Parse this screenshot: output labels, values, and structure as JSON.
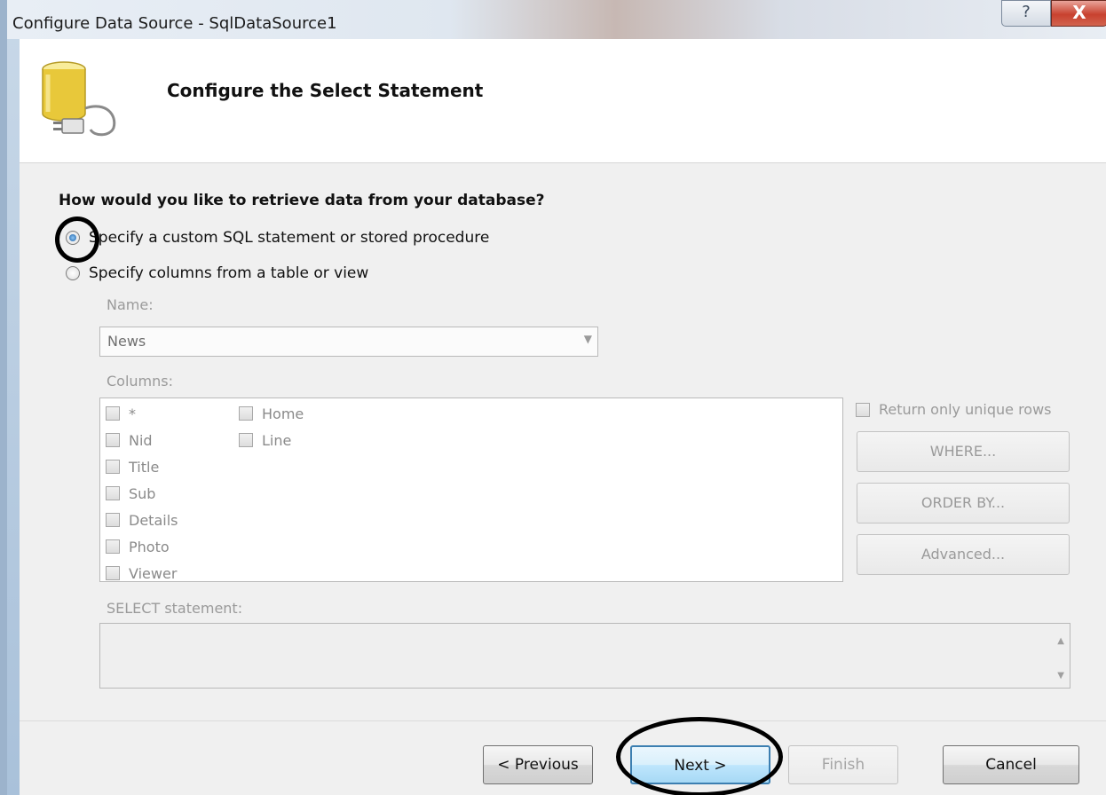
{
  "window": {
    "title": "Configure Data Source - SqlDataSource1",
    "help_label": "?",
    "close_label": "X"
  },
  "header": {
    "title": "Configure the Select Statement",
    "icon": "database-plug-icon"
  },
  "question": "How would you like to retrieve data from your database?",
  "options": {
    "custom_sql": {
      "label": "Specify a custom SQL statement or stored procedure",
      "selected": true
    },
    "table_view": {
      "label": "Specify columns from a table or view",
      "selected": false
    }
  },
  "name_field": {
    "label": "Name:",
    "value": "News"
  },
  "columns": {
    "label": "Columns:",
    "col1": [
      "*",
      "Nid",
      "Title",
      "Sub",
      "Details",
      "Photo",
      "Viewer"
    ],
    "col2": [
      "Home",
      "Line"
    ]
  },
  "side": {
    "unique_label": "Return only unique rows",
    "where_label": "WHERE...",
    "orderby_label": "ORDER BY...",
    "advanced_label": "Advanced..."
  },
  "select_statement": {
    "label": "SELECT statement:",
    "value": ""
  },
  "footer": {
    "previous_label": "< Previous",
    "next_label": "Next >",
    "finish_label": "Finish",
    "cancel_label": "Cancel"
  },
  "colors": {
    "accent": "#3c7fb1",
    "close_red": "#c8412f",
    "annotation": "#000000"
  }
}
